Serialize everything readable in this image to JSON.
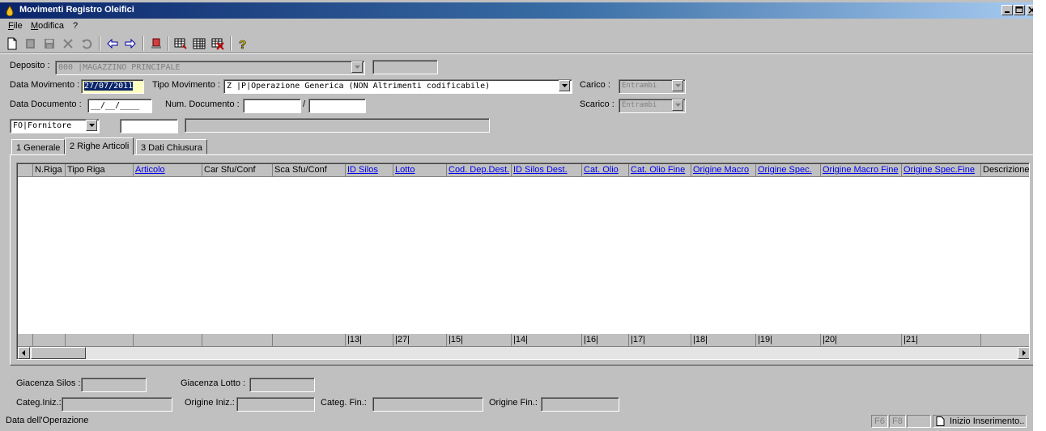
{
  "window": {
    "title": "Movimenti Registro Oleifici"
  },
  "menu": {
    "file": "File",
    "modifica": "Modifica",
    "help": "?"
  },
  "form": {
    "deposito_label": "Deposito :",
    "deposito_value": "000        |MAGAZZINO PRINCIPALE",
    "data_movimento_label": "Data Movimento :",
    "data_movimento_value": "27/07/2011",
    "tipo_movimento_label": "Tipo Movimento :",
    "tipo_movimento_value": "Z     |P|Operazione Generica (NON Altrimenti codificabile)",
    "carico_label": "Carico :",
    "carico_value": "Entrambi",
    "data_documento_label": "Data Documento :",
    "data_documento_value": "__/__/____",
    "num_documento_label": "Num. Documento :",
    "num_documento_sep": "/",
    "scarico_label": "Scarico :",
    "scarico_value": "Entrambi",
    "fornitore_value": "FO|Fornitore"
  },
  "tabs": [
    {
      "label": "1 Generale"
    },
    {
      "label": "2 Righe Articoli"
    },
    {
      "label": "3 Dati Chiusura"
    }
  ],
  "grid": {
    "columns": [
      "",
      "N.Riga",
      "Tipo Riga",
      "Articolo",
      "Car Sfu/Conf",
      "Sca Sfu/Conf",
      "ID Silos",
      "Lotto",
      "Cod. Dep.Dest.",
      "ID Silos Dest.",
      "Cat. Olio",
      "Cat. Olio Fine",
      "Origine Macro",
      "Origine Spec.",
      "Origine Macro Fine",
      "Origine Spec.Fine",
      "Descrizione"
    ],
    "footer": [
      "",
      "",
      "",
      "",
      "",
      "",
      "|13|",
      "|27|",
      "|15|",
      "|14|",
      "|16|",
      "|17|",
      "|18|",
      "|19|",
      "|20|",
      "|21|",
      ""
    ]
  },
  "bottom": {
    "giacenza_silos_label": "Giacenza Silos :",
    "giacenza_lotto_label": "Giacenza Lotto :",
    "categ_iniz_label": "Categ.Iniz.:",
    "origine_iniz_label": "Origine Iniz.:",
    "categ_fin_label": "Categ. Fin.:",
    "origine_fin_label": "Origine Fin.:"
  },
  "status": {
    "message": "Data dell'Operazione",
    "f6": "F6",
    "f8": "F8",
    "mode": "Inizio Inserimento.."
  }
}
